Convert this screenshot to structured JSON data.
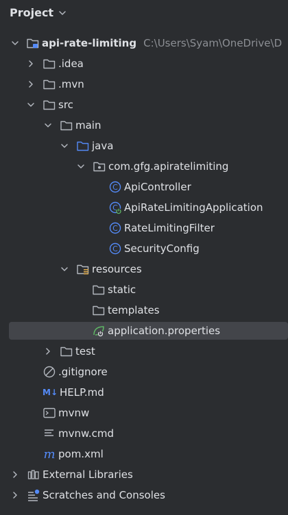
{
  "panel": {
    "title": "Project"
  },
  "tree": {
    "root": {
      "label": "api-rate-limiting",
      "path": "C:\\Users\\Syam\\OneDrive\\D"
    },
    "idea": {
      "label": ".idea"
    },
    "mvn": {
      "label": ".mvn"
    },
    "src": {
      "label": "src"
    },
    "main": {
      "label": "main"
    },
    "java": {
      "label": "java"
    },
    "package": {
      "label": "com.gfg.apiratelimiting"
    },
    "api_controller": {
      "label": "ApiController"
    },
    "application": {
      "label": "ApiRateLimitingApplication"
    },
    "filter": {
      "label": "RateLimitingFilter"
    },
    "security": {
      "label": "SecurityConfig"
    },
    "resources": {
      "label": "resources"
    },
    "static": {
      "label": "static"
    },
    "templates": {
      "label": "templates"
    },
    "properties": {
      "label": "application.properties"
    },
    "test": {
      "label": "test"
    },
    "gitignore": {
      "label": ".gitignore"
    },
    "help": {
      "label": "HELP.md",
      "badge": "M↓"
    },
    "mvnw": {
      "label": "mvnw"
    },
    "mvnw_cmd": {
      "label": "mvnw.cmd"
    },
    "pom": {
      "label": "pom.xml",
      "badge": "m"
    },
    "libraries": {
      "label": "External Libraries"
    },
    "scratches": {
      "label": "Scratches and Consoles"
    }
  },
  "colors": {
    "background": "#2b2d30",
    "text": "#dfe1e5",
    "muted": "#8c8f94",
    "selection": "#43454a",
    "class_icon": "#548af7",
    "spring": "#5fb865"
  }
}
